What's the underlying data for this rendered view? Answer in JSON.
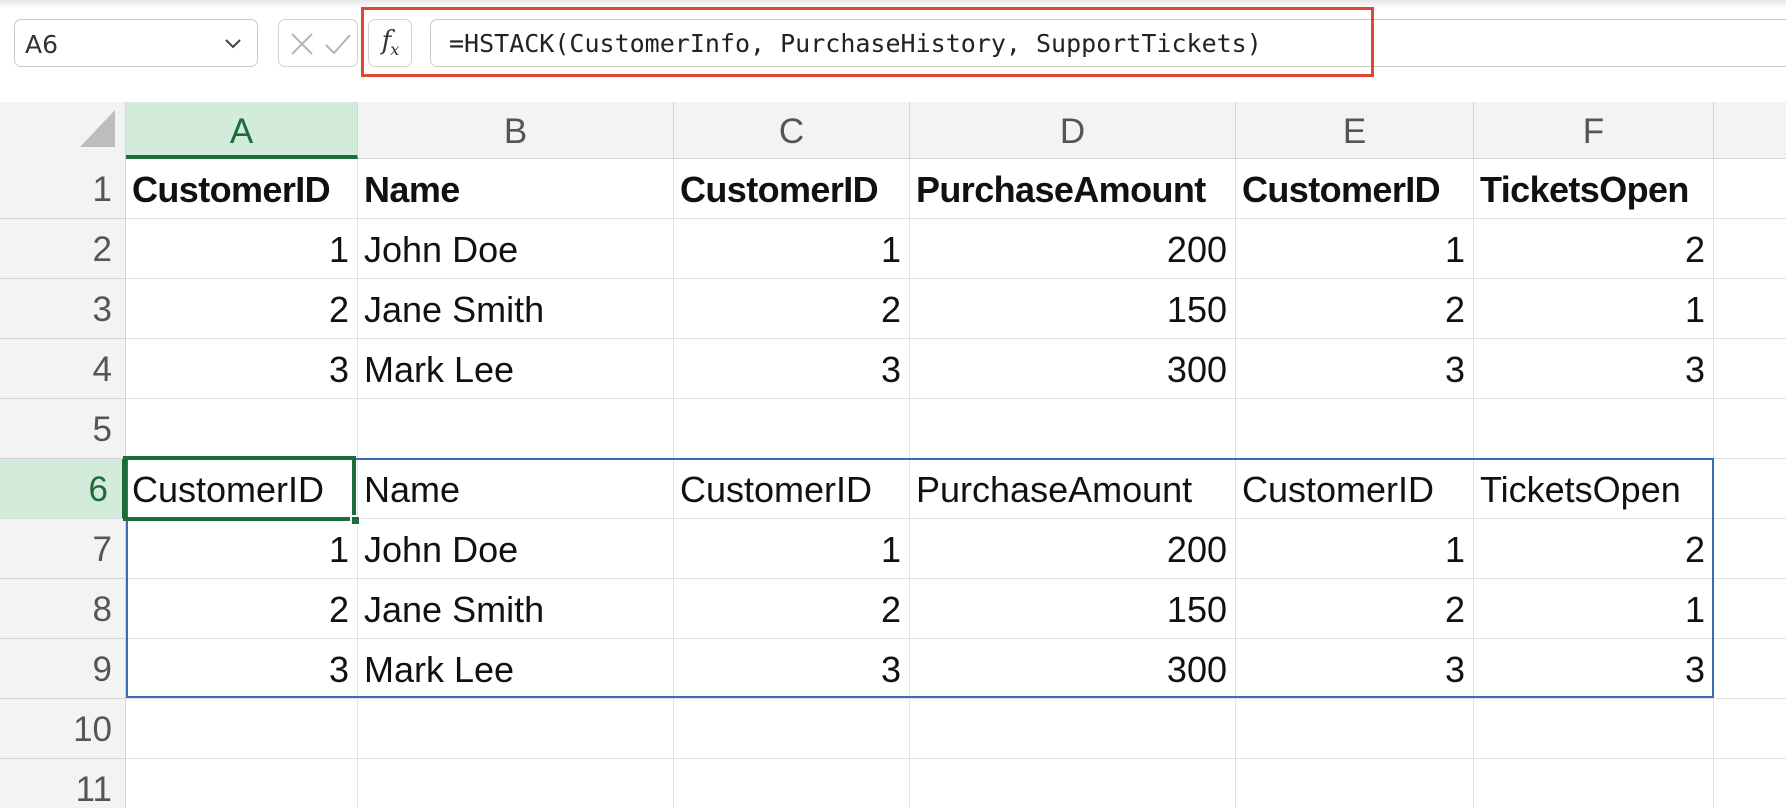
{
  "formula_bar": {
    "name_box": "A6",
    "formula": "=HSTACK(CustomerInfo, PurchaseHistory, SupportTickets)",
    "fx_label": "f",
    "fx_sub": "x",
    "highlight_color": "#dc4b31"
  },
  "icons": [
    "chevron-down-icon",
    "cancel-x-icon",
    "confirm-check-icon",
    "function-fx-icon",
    "select-all-corner-icon"
  ],
  "colors": {
    "selection_green": "#1e6b3a",
    "header_highlight": "#d3ebda",
    "spill_border": "#3b6bb8"
  },
  "columns": [
    "A",
    "B",
    "C",
    "D",
    "E",
    "F"
  ],
  "active_column": "A",
  "rows": [
    "1",
    "2",
    "3",
    "4",
    "5",
    "6",
    "7",
    "8",
    "9",
    "10",
    "11"
  ],
  "active_row": "6",
  "cells": {
    "r1": [
      "CustomerID",
      "Name",
      "CustomerID",
      "PurchaseAmount",
      "CustomerID",
      "TicketsOpen"
    ],
    "r2": [
      "1",
      "John Doe",
      "1",
      "200",
      "1",
      "2"
    ],
    "r3": [
      "2",
      "Jane Smith",
      "2",
      "150",
      "2",
      "1"
    ],
    "r4": [
      "3",
      "Mark Lee",
      "3",
      "300",
      "3",
      "3"
    ],
    "r5": [
      "",
      "",
      "",
      "",
      "",
      ""
    ],
    "r6": [
      "CustomerID",
      "Name",
      "CustomerID",
      "PurchaseAmount",
      "CustomerID",
      "TicketsOpen"
    ],
    "r7": [
      "1",
      "John Doe",
      "1",
      "200",
      "1",
      "2"
    ],
    "r8": [
      "2",
      "Jane Smith",
      "2",
      "150",
      "2",
      "1"
    ],
    "r9": [
      "3",
      "Mark Lee",
      "3",
      "300",
      "3",
      "3"
    ],
    "r10": [
      "",
      "",
      "",
      "",
      "",
      ""
    ],
    "r11": [
      "",
      "",
      "",
      "",
      "",
      ""
    ]
  },
  "selected_cell": "A6",
  "spill_range": "A6:F9"
}
